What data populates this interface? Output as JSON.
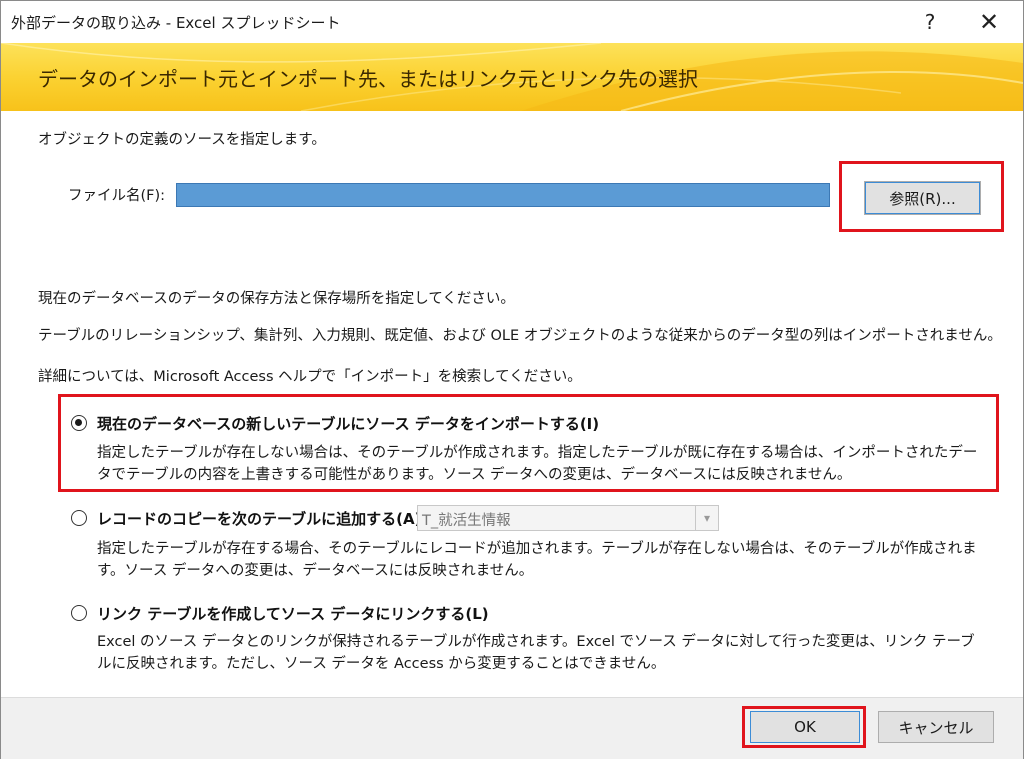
{
  "window": {
    "title": "外部データの取り込み - Excel スプレッドシート",
    "help_label": "?",
    "close_label": "✕"
  },
  "banner": {
    "heading": "データのインポート元とインポート先、またはリンク元とリンク先の選択"
  },
  "source": {
    "intro": "オブジェクトの定義のソースを指定します。",
    "file_label": "ファイル名(F):",
    "file_value": "",
    "browse_label": "参照(R)..."
  },
  "info": {
    "line1": "現在のデータベースのデータの保存方法と保存場所を指定してください。",
    "line2": "テーブルのリレーションシップ、集計列、入力規則、既定値、および OLE オブジェクトのような従来からのデータ型の列はインポートされません。",
    "line3": "詳細については、Microsoft Access ヘルプで「インポート」を検索してください。"
  },
  "options": [
    {
      "label": "現在のデータベースの新しいテーブルにソース データをインポートする(I)",
      "selected": true,
      "description": "指定したテーブルが存在しない場合は、そのテーブルが作成されます。指定したテーブルが既に存在する場合は、インポートされたデータでテーブルの内容を上書きする可能性があります。ソース データへの変更は、データベースには反映されません。"
    },
    {
      "label": "レコードのコピーを次のテーブルに追加する(A):",
      "selected": false,
      "combo_value": "T_就活生情報",
      "description": "指定したテーブルが存在する場合、そのテーブルにレコードが追加されます。テーブルが存在しない場合は、そのテーブルが作成されます。ソース データへの変更は、データベースには反映されません。"
    },
    {
      "label": "リンク テーブルを作成してソース データにリンクする(L)",
      "selected": false,
      "description": "Excel のソース データとのリンクが保持されるテーブルが作成されます。Excel でソース データに対して行った変更は、リンク テーブルに反映されます。ただし、ソース データを Access から変更することはできません。"
    }
  ],
  "footer": {
    "ok_label": "OK",
    "cancel_label": "キャンセル"
  },
  "colors": {
    "highlight": "#e0141c",
    "banner": "#fbd232",
    "file_field": "#5b9bd5"
  }
}
